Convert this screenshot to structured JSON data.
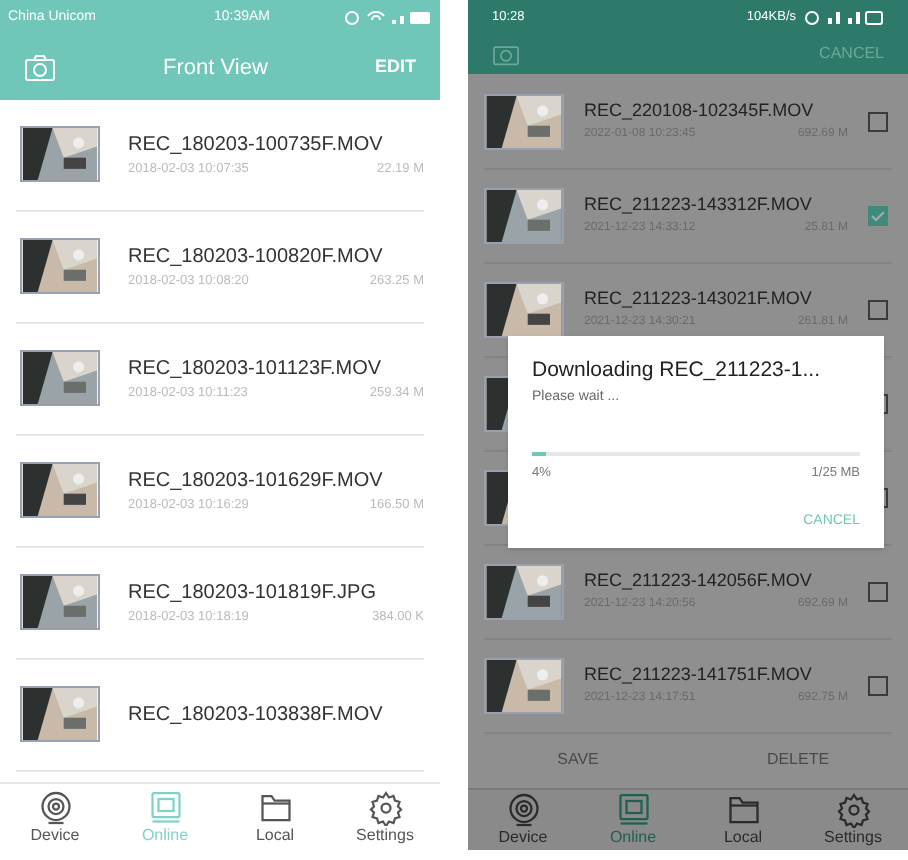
{
  "left_screen": {
    "status_bar": {
      "carrier": "China Unicom",
      "time": "10:39AM"
    },
    "header": {
      "title": "Front View",
      "action": "EDIT"
    },
    "files": [
      {
        "name": "REC_180203-100735F.MOV",
        "date": "2018-02-03 10:07:35",
        "size": "22.19 M"
      },
      {
        "name": "REC_180203-100820F.MOV",
        "date": "2018-02-03 10:08:20",
        "size": "263.25 M"
      },
      {
        "name": "REC_180203-101123F.MOV",
        "date": "2018-02-03 10:11:23",
        "size": "259.34 M"
      },
      {
        "name": "REC_180203-101629F.MOV",
        "date": "2018-02-03 10:16:29",
        "size": "166.50 M"
      },
      {
        "name": "REC_180203-101819F.JPG",
        "date": "2018-02-03 10:18:19",
        "size": "384.00 K"
      },
      {
        "name": "REC_180203-103838F.MOV"
      }
    ],
    "tabs": [
      {
        "label": "Device",
        "selected": false
      },
      {
        "label": "Online",
        "selected": true
      },
      {
        "label": "Local",
        "selected": false
      },
      {
        "label": "Settings",
        "selected": false
      }
    ]
  },
  "right_screen": {
    "status_bar": {
      "time": "10:28",
      "speed": "104KB/s"
    },
    "header": {
      "action": "CANCEL"
    },
    "files": [
      {
        "kind": "row",
        "name": "REC_220108-102345F.MOV",
        "date": "2022-01-08 10:23:45",
        "size": "692.69 M",
        "checked": false
      },
      {
        "kind": "row",
        "name": "REC_211223-143312F.MOV",
        "date": "2021-12-23 14:33:12",
        "size": "25.81 M",
        "checked": true
      },
      {
        "kind": "row",
        "name": "REC_211223-143021F.MOV",
        "date": "2021-12-23 14:30:21",
        "size": "261.81 M",
        "checked": false
      },
      {
        "kind": "covered",
        "checked": false
      },
      {
        "kind": "covered",
        "checked": false
      },
      {
        "kind": "row",
        "name": "REC_211223-142056F.MOV",
        "date": "2021-12-23 14:20:56",
        "size": "692.69 M",
        "checked": false
      },
      {
        "kind": "row",
        "name": "REC_211223-141751F.MOV",
        "date": "2021-12-23 14:17:51",
        "size": "692.75 M",
        "checked": false
      }
    ],
    "actions": [
      "SAVE",
      "DELETE"
    ],
    "tabs": [
      {
        "label": "Device",
        "selected": false
      },
      {
        "label": "Online",
        "selected": true
      },
      {
        "label": "Local",
        "selected": false
      },
      {
        "label": "Settings",
        "selected": false
      }
    ],
    "dialog": {
      "title": "Downloading REC_211223-1...",
      "message": "Please wait ...",
      "level": 0.04,
      "percent": "4%",
      "amount": "1/25 MB",
      "button": "CANCEL"
    }
  }
}
